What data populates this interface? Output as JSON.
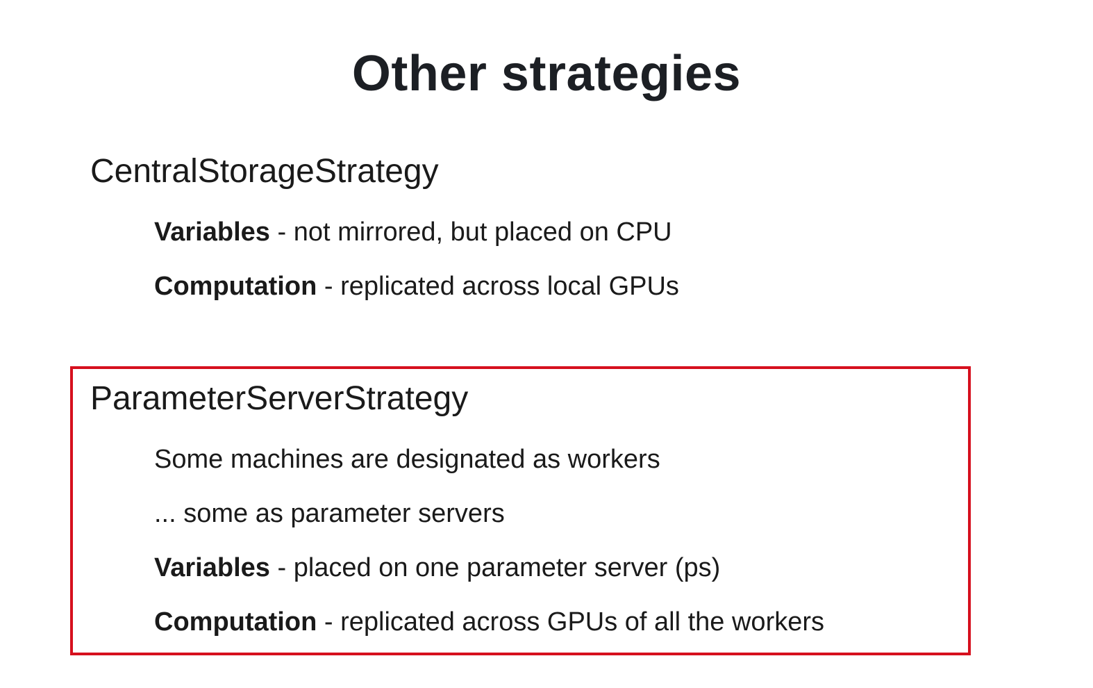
{
  "slide": {
    "title": "Other strategies",
    "sections": [
      {
        "heading": "CentralStorageStrategy",
        "highlighted": false,
        "items": [
          {
            "term": "Variables",
            "separator": " - ",
            "text": "not mirrored, but placed on CPU"
          },
          {
            "term": "Computation",
            "separator": " - ",
            "text": "replicated across local GPUs"
          }
        ]
      },
      {
        "heading": "ParameterServerStrategy",
        "highlighted": true,
        "highlight_color": "#d6101e",
        "items": [
          {
            "term": "",
            "separator": "",
            "text": "Some machines are designated as workers"
          },
          {
            "term": "",
            "separator": "",
            "text": "... some as parameter servers"
          },
          {
            "term": "Variables",
            "separator": " - ",
            "text": "placed on one parameter server (ps)"
          },
          {
            "term": "Computation",
            "separator": " - ",
            "text": "replicated across GPUs of all the workers"
          }
        ]
      }
    ]
  }
}
